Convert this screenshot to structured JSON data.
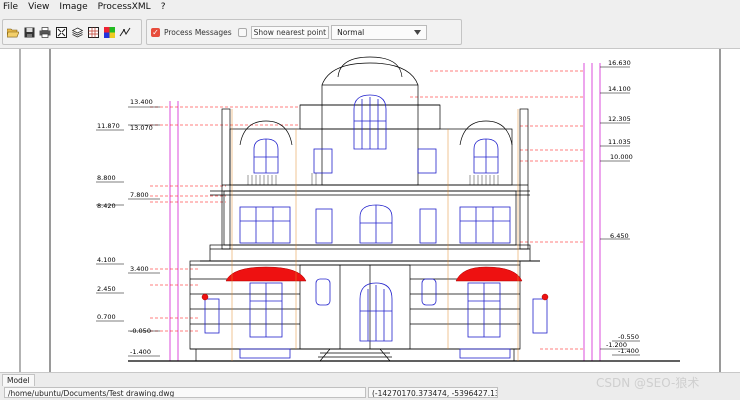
{
  "menu": [
    "File",
    "View",
    "Image",
    "ProcessXML",
    "?"
  ],
  "toolbar": {
    "buttons": [
      "open-folder-icon",
      "save-icon",
      "print-icon",
      "zoom-fit-icon",
      "layers-icon",
      "grid-icon",
      "color-icon",
      "snap-icon"
    ],
    "process_messages_label": "Process Messages",
    "process_messages_checked": true,
    "show_nearest_label": "Show nearest point",
    "show_nearest_checked": false,
    "render_mode": "Normal"
  },
  "drawing": {
    "left_levels": [
      "13.400",
      "13.070",
      "11.870",
      "8.800",
      "7.800",
      "8.420",
      "4.100",
      "3.400",
      "2.450",
      "0.700",
      "-0.050",
      "-1.400"
    ],
    "right_levels": [
      "16.630",
      "14.100",
      "12.305",
      "11.035",
      "10.000",
      "6.450",
      "-0.550",
      "-1.200",
      "-1.400"
    ]
  },
  "tabs": [
    "Model"
  ],
  "status": {
    "file_path": "/home/ubuntu/Documents/Test drawing.dwg",
    "coordinates": "(-14270170.373474, -5396427.13116"
  },
  "watermark": "CSDN @SEO-狼术",
  "colors": {
    "accent": "#e74c3c",
    "dim_red": "#ff0000",
    "dim_magenta": "#cc00cc",
    "window_blue": "#2222cc"
  }
}
